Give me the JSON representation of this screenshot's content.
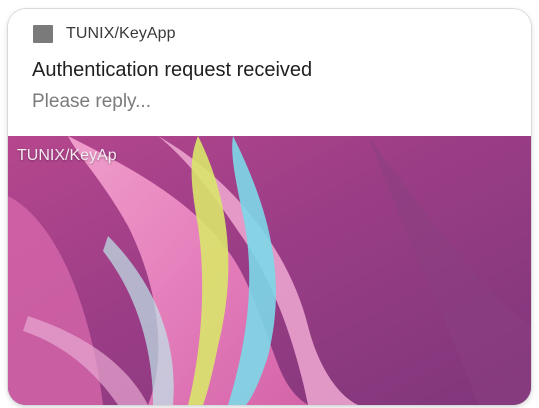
{
  "notification": {
    "app_name": "TUNIX/KeyApp",
    "app_icon": "app-square-icon",
    "title": "Authentication request received",
    "message": "Please reply...",
    "image_overlay_text": "TUNIX/KeyApp"
  },
  "colors": {
    "background_purple": "#8a3a7e",
    "pink": "#e97bb9",
    "cyan": "#7ad8e6",
    "yellow": "#d7e465"
  }
}
